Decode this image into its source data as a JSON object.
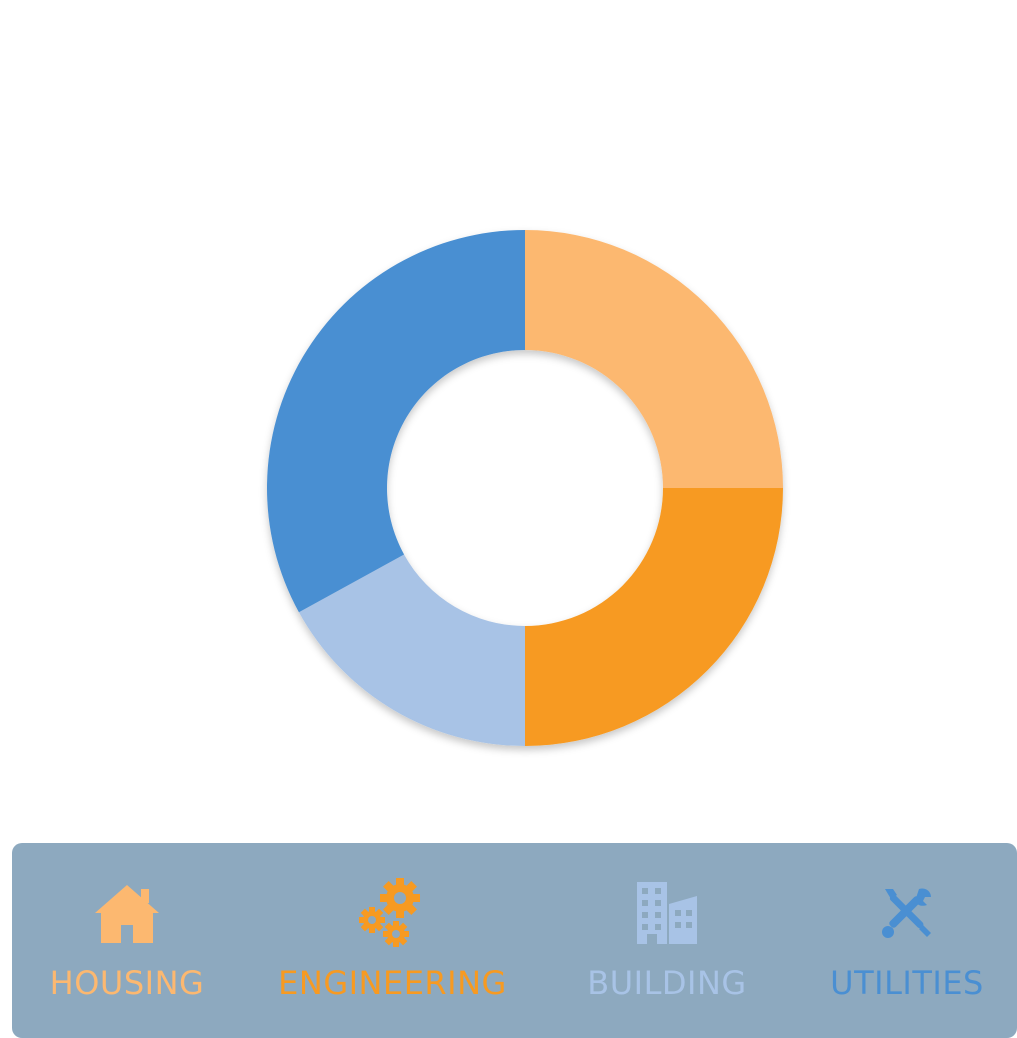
{
  "chart_data": {
    "type": "pie",
    "donut": true,
    "legend_placement": "bottom",
    "series": [
      {
        "name": "HOUSING",
        "value": 25,
        "color": "#fcb870",
        "icon": "house-icon"
      },
      {
        "name": "ENGINEERING",
        "value": 25,
        "color": "#f79a21",
        "icon": "gears-icon"
      },
      {
        "name": "BUILDING",
        "value": 17,
        "color": "#a8c3e6",
        "icon": "buildings-icon"
      },
      {
        "name": "UTILITIES",
        "value": 33,
        "color": "#4a8fd2",
        "icon": "tools-icon"
      }
    ]
  },
  "legend": {
    "background": "#8da9bf",
    "items": [
      {
        "label": "HOUSING",
        "color": "#fcb870"
      },
      {
        "label": "ENGINEERING",
        "color": "#f79a21"
      },
      {
        "label": "BUILDING",
        "color": "#a8c3e6"
      },
      {
        "label": "UTILITIES",
        "color": "#4a8fd2"
      }
    ]
  }
}
